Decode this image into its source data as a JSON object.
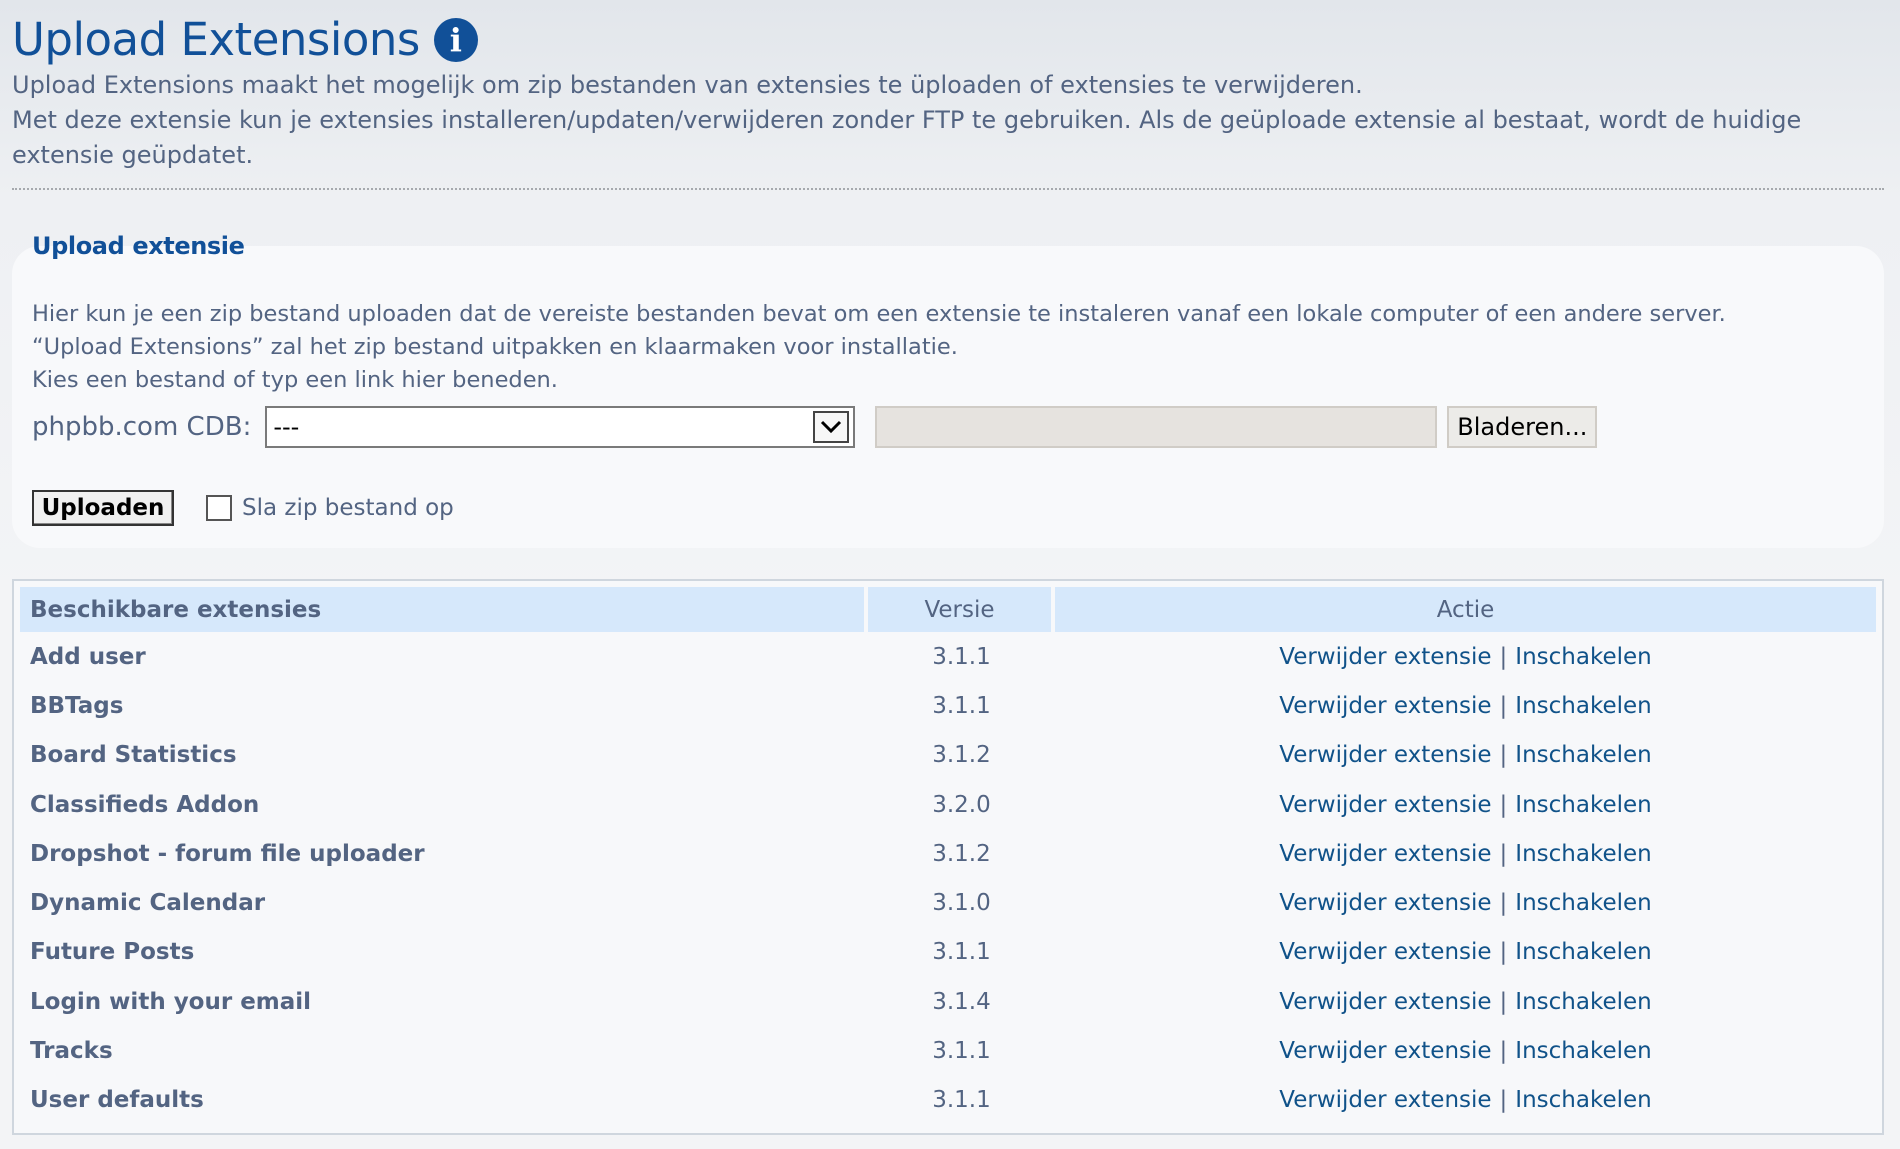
{
  "header": {
    "title": "Upload Extensions",
    "intro_line1": "Upload Extensions maakt het mogelijk om zip bestanden van extensies te üploaden of extensies te verwijderen.",
    "intro_line2": "Met deze extensie kun je extensies installeren/updaten/verwijderen zonder FTP te gebruiken. Als de geüploade extensie al bestaat, wordt de huidige extensie geüpdatet."
  },
  "upload_panel": {
    "title": "Upload extensie",
    "desc_line1": "Hier kun je een zip bestand uploaden dat de vereiste bestanden bevat om een extensie te instaleren vanaf een lokale computer of een andere server.",
    "desc_line2": "“Upload Extensions” zal het zip bestand uitpakken en klaarmaken voor installatie.",
    "desc_line3": "Kies een bestand of typ een link hier beneden.",
    "cdb_label": "phpbb.com CDB:",
    "cdb_selected": "---",
    "browse_label": "Bladeren...",
    "upload_label": "Uploaden",
    "save_zip_label": "Sla zip bestand op"
  },
  "table": {
    "headers": {
      "name": "Beschikbare extensies",
      "version": "Versie",
      "action": "Actie"
    },
    "remove_label": "Verwijder extensie",
    "separator": "|",
    "enable_label": "Inschakelen",
    "rows": [
      {
        "name": "Add user",
        "version": "3.1.1"
      },
      {
        "name": "BBTags",
        "version": "3.1.1"
      },
      {
        "name": "Board Statistics",
        "version": "3.1.2"
      },
      {
        "name": "Classifieds Addon",
        "version": "3.2.0"
      },
      {
        "name": "Dropshot - forum file uploader",
        "version": "3.1.2"
      },
      {
        "name": "Dynamic Calendar",
        "version": "3.1.0"
      },
      {
        "name": "Future Posts",
        "version": "3.1.1"
      },
      {
        "name": "Login with your email",
        "version": "3.1.4"
      },
      {
        "name": "Tracks",
        "version": "3.1.1"
      },
      {
        "name": "User defaults",
        "version": "3.1.1"
      }
    ]
  },
  "icons": {
    "info": "info-icon",
    "dropdown": "chevron-down-icon"
  }
}
